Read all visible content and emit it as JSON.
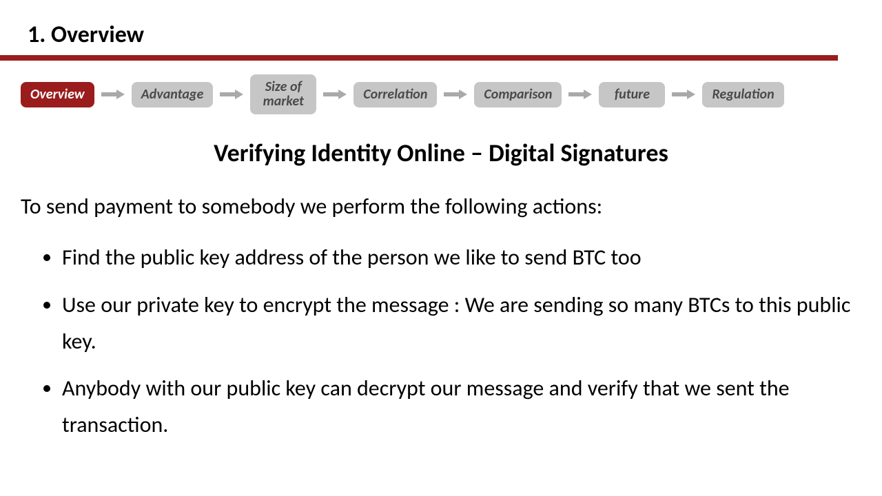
{
  "colors": {
    "accent": "#9a1c1c",
    "pill_inactive_bg": "#c6c6c6",
    "pill_inactive_fg": "#4a4a4a",
    "arrow": "#a9a9a9"
  },
  "header": {
    "section_title": "1. Overview"
  },
  "nav": {
    "items": [
      {
        "label": "Overview",
        "active": true
      },
      {
        "label": "Advantage",
        "active": false
      },
      {
        "label": "Size of\nmarket",
        "active": false
      },
      {
        "label": "Correlation",
        "active": false
      },
      {
        "label": "Comparison",
        "active": false
      },
      {
        "label": "future",
        "active": false
      },
      {
        "label": "Regulation",
        "active": false
      }
    ]
  },
  "content": {
    "title": "Verifying Identity Online – Digital Signatures",
    "intro": "To send payment to somebody we perform the following actions:",
    "bullets": [
      "Find the public key address of the person we like to send BTC too",
      "Use our private key to encrypt the message : We are sending so many BTCs to this public key.",
      "Anybody with our public key can decrypt our message and verify that we sent the transaction."
    ]
  }
}
